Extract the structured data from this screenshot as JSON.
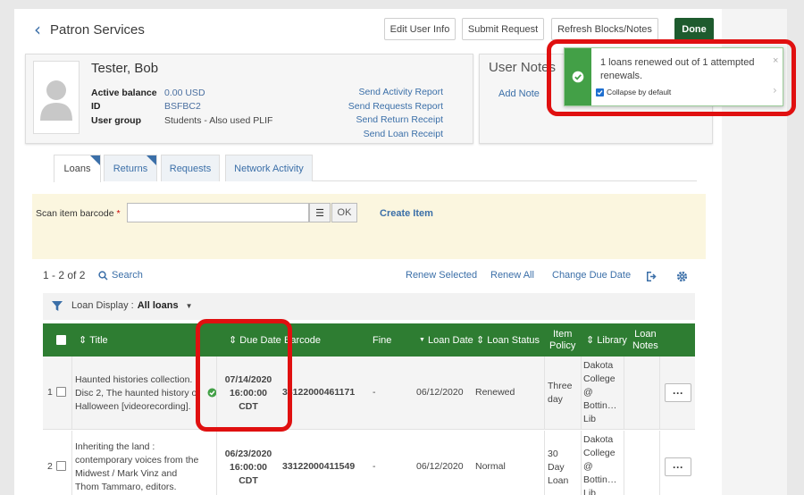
{
  "header": {
    "title": "Patron Services",
    "buttons": {
      "edit": "Edit User Info",
      "submit": "Submit Request",
      "refresh": "Refresh Blocks/Notes",
      "done": "Done"
    }
  },
  "patron": {
    "name": "Tester, Bob",
    "fields": [
      {
        "label": "Active balance",
        "value": "0.00 USD"
      },
      {
        "label": "ID",
        "value": "BSFBC2"
      },
      {
        "label": "User group",
        "value": "Students - Also used PLIF"
      }
    ],
    "links": [
      "Send Activity Report",
      "Send Requests Report",
      "Send Return Receipt",
      "Send Loan Receipt"
    ]
  },
  "user_notes": {
    "title": "User Notes",
    "add": "Add Note"
  },
  "toast": {
    "message": "1 loans renewed out of 1 attempted renewals.",
    "collapse": "Collapse by default"
  },
  "tabs": [
    "Loans",
    "Returns",
    "Requests",
    "Network Activity"
  ],
  "scan": {
    "label": "Scan item barcode",
    "required": "*",
    "ok": "OK",
    "create": "Create Item"
  },
  "list": {
    "count": "1 - 2 of 2",
    "search": "Search",
    "actions": [
      "Renew Selected",
      "Renew All",
      "Change Due Date"
    ],
    "display_label": "Loan Display :",
    "display_value": "All loans"
  },
  "columns": {
    "title": "Title",
    "due": "Due Date",
    "barcode": "Barcode",
    "fine": "Fine",
    "loan_date": "Loan Date",
    "status": "Loan Status",
    "policy_1": "Item",
    "policy_2": "Policy",
    "library": "Library",
    "notes_1": "Loan",
    "notes_2": "Notes"
  },
  "rows": [
    {
      "num": "1",
      "title": [
        "Haunted histories collection.",
        "Disc 2, The haunted history of",
        "Halloween [videorecording]."
      ],
      "due": [
        "07/14/2020",
        "16:00:00",
        "CDT"
      ],
      "barcode": "33122000461171",
      "fine": "-",
      "loan_date": "06/12/2020",
      "status": "Renewed",
      "policy": [
        "Three",
        "day"
      ],
      "library": [
        "Dakota",
        "College",
        "@",
        "Bottin…",
        "Lib"
      ],
      "more": "···"
    },
    {
      "num": "2",
      "title": [
        "Inheriting the land :",
        "contemporary voices from the",
        "Midwest / Mark Vinz and",
        "Thom Tammaro, editors."
      ],
      "due": [
        "06/23/2020",
        "16:00:00",
        "CDT"
      ],
      "barcode": "33122000411549",
      "fine": "-",
      "loan_date": "06/12/2020",
      "status": "Normal",
      "policy": [
        "30",
        "Day",
        "Loan"
      ],
      "library": [
        "Dakota",
        "College",
        "@",
        "Bottin…",
        "Lib"
      ],
      "more": "···"
    }
  ],
  "colors": {
    "accent": "#3b6fa8",
    "header_green": "#2e7d32",
    "done_green": "#1e5b2e",
    "highlight": "#e01010"
  }
}
